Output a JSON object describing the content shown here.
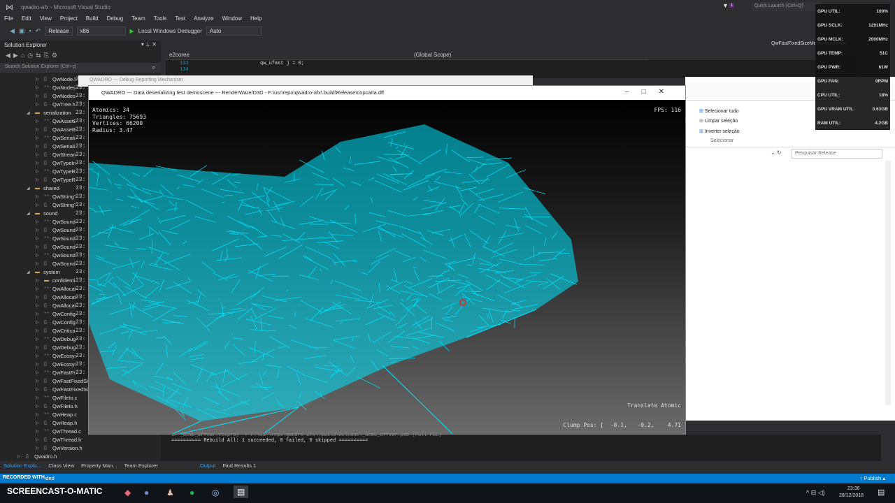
{
  "app": {
    "title": "qwadro-afx - Microsoft Visual Studio",
    "quick_launch": "Quick Launch (Ctrl+Q)",
    "notifications": "1"
  },
  "menu": [
    "File",
    "Edit",
    "View",
    "Project",
    "Build",
    "Debug",
    "Team",
    "Tools",
    "Test",
    "Analyze",
    "Window",
    "Help"
  ],
  "toolbar": {
    "config": "Release",
    "platform": "x86",
    "debugger": "Local Windows Debugger",
    "mode": "Auto"
  },
  "solution_explorer": {
    "title": "Solution Explorer",
    "search_placeholder": "Search Solution Explorer (Ctrl+ç)",
    "items": [
      {
        "label": "QwNode.h",
        "level": 3,
        "type": "h"
      },
      {
        "label": "QwNodesHandler.c",
        "level": 3,
        "type": "c"
      },
      {
        "label": "QwNodesHandler.h",
        "level": 3,
        "type": "h"
      },
      {
        "label": "QwTree.h",
        "level": 3,
        "type": "h"
      },
      {
        "label": "serialization",
        "level": 2,
        "type": "folder"
      },
      {
        "label": "QwAssetBundle.c",
        "level": 3,
        "type": "c"
      },
      {
        "label": "QwAssetBundle.h",
        "level": 3,
        "type": "h"
      },
      {
        "label": "QwSerializer.c",
        "level": 3,
        "type": "c"
      },
      {
        "label": "QwSerializer.h",
        "level": 3,
        "type": "h"
      },
      {
        "label": "QwStream.h",
        "level": 3,
        "type": "h"
      },
      {
        "label": "QwTypeInfo.h",
        "level": 3,
        "type": "h"
      },
      {
        "label": "QwTypeRegistry.c",
        "level": 3,
        "type": "c"
      },
      {
        "label": "QwTypeRegistry.h",
        "level": 3,
        "type": "h"
      },
      {
        "label": "shared",
        "level": 2,
        "type": "folder"
      },
      {
        "label": "QwStringTable.c",
        "level": 3,
        "type": "c"
      },
      {
        "label": "QwStringTable.h",
        "level": 3,
        "type": "h"
      },
      {
        "label": "sound",
        "level": 2,
        "type": "folder"
      },
      {
        "label": "QwSoundBuffer.c",
        "level": 3,
        "type": "c"
      },
      {
        "label": "QwSoundBuffer.h",
        "level": 3,
        "type": "h"
      },
      {
        "label": "QwSoundSource.c",
        "level": 3,
        "type": "c"
      },
      {
        "label": "QwSoundSource.h",
        "level": 3,
        "type": "h"
      },
      {
        "label": "QwSoundSystem.c",
        "level": 3,
        "type": "c"
      },
      {
        "label": "QwSoundSystem.h",
        "level": 3,
        "type": "h"
      },
      {
        "label": "system",
        "level": 2,
        "type": "folder"
      },
      {
        "label": "confidential",
        "level": 3,
        "type": "folder"
      },
      {
        "label": "QwAllocation.c",
        "level": 3,
        "type": "c"
      },
      {
        "label": "QwAllocation.h",
        "level": 3,
        "type": "h"
      },
      {
        "label": "QwAllocator.h",
        "level": 3,
        "type": "h"
      },
      {
        "label": "QwConfigFile.c",
        "level": 3,
        "type": "c"
      },
      {
        "label": "QwConfigFile.h",
        "level": 3,
        "type": "h"
      },
      {
        "label": "QwCriticalSection.h",
        "level": 3,
        "type": "h"
      },
      {
        "label": "QwDebug.c",
        "level": 3,
        "type": "c"
      },
      {
        "label": "QwDebug.h",
        "level": 3,
        "type": "h"
      },
      {
        "label": "QwEcosystem.c",
        "level": 3,
        "type": "c"
      },
      {
        "label": "QwEcosystem.h",
        "level": 3,
        "type": "h"
      },
      {
        "label": "QwFastFixedSizeMemAllocation.c",
        "level": 3,
        "type": "c"
      },
      {
        "label": "QwFastFixedSizeMemAllocation.h",
        "level": 3,
        "type": "h"
      },
      {
        "label": "QwFastFixedSizeMem",
        "level": 3,
        "type": "h"
      },
      {
        "label": "QwFileIo.c",
        "level": 3,
        "type": "c"
      },
      {
        "label": "QwFileIo.h",
        "level": 3,
        "type": "h"
      },
      {
        "label": "QwHeap.c",
        "level": 3,
        "type": "c"
      },
      {
        "label": "QwHeap.h",
        "level": 3,
        "type": "h"
      },
      {
        "label": "QwThread.c",
        "level": 3,
        "type": "c"
      },
      {
        "label": "QwThread.h",
        "level": 3,
        "type": "h"
      },
      {
        "label": "QwVersion.h",
        "level": 3,
        "type": "h"
      },
      {
        "label": "Qwadro.h",
        "level": 1,
        "type": "h"
      }
    ],
    "timestamp_prefix": "23:"
  },
  "editor": {
    "file_combo": "e2coree",
    "scope": "(Global Scope)",
    "lines": [
      {
        "n": "133",
        "code": "qw_ufast j = 0;"
      },
      {
        "n": "134",
        "code": ""
      }
    ],
    "side_tab": "QwFastFixedSizeMemAllocation.c"
  },
  "debug_window": {
    "title": "QWADRO --- Debug Reporting Mechanism"
  },
  "render_window": {
    "title": "QWADRO --- Data deserializing test demoscene --- RenderWare/D3D - F:\\usr\\repo\\qwadro-afx\\.build\\Release\\copcarla.dff",
    "stats": [
      "Atomics: 34",
      "Triangles: 75693",
      "Vertices: 66200",
      "Radius: 3.47"
    ],
    "fps": "FPS: 116",
    "mode": "Translate Atomic",
    "clump_pos": "Clump Pos: [  -0.1,   -0.2,    4.71",
    "wire_color": "#00e5ff"
  },
  "explorer": {
    "selecionar_tudo": "Selecionar tudo",
    "limpar": "Limpar seleção",
    "inverter": "Inverter seleção",
    "group": "Selecionar",
    "search_placeholder": "Pesquisar Release",
    "folder": "Release"
  },
  "gpu_overlay": [
    {
      "k": "GPU UTIL:",
      "v": "100%"
    },
    {
      "k": "GPU SCLK:",
      "v": "1291MHz"
    },
    {
      "k": "GPU MCLK:",
      "v": "2000MHz"
    },
    {
      "k": "GPU TEMP:",
      "v": "51C"
    },
    {
      "k": "GPU PWR:",
      "v": "61W"
    },
    {
      "k": "GPU FAN:",
      "v": "0RPM"
    },
    {
      "k": "CPU UTIL:",
      "v": "18%"
    },
    {
      "k": "GPU VRAM UTIL:",
      "v": "0.63GB"
    },
    {
      "k": "RAM UTIL:",
      "v": "4.2GB"
    }
  ],
  "output": {
    "lines": [
      "1>  _demo_dffvwr.vcxproj -> F:\\usr\\repo\\qwadro-afx\\.build\\Release\\_demo_dffvwr.pdb (Full PDB)",
      "========== Rebuild All: 1 succeeded, 0 failed, 0 skipped =========="
    ]
  },
  "bottom_tabs": [
    "Solution Explo...",
    "Class View",
    "Property Man...",
    "Team Explorer",
    "Output",
    "Find Results 1"
  ],
  "status": {
    "left": "Rebuild All succeeded",
    "publish": "Publish"
  },
  "watermark": {
    "line1": "RECORDED WITH",
    "line2": "SCREENCAST-O-MATIC"
  },
  "taskbar": {
    "time": "23:36",
    "date": "28/12/2018"
  }
}
